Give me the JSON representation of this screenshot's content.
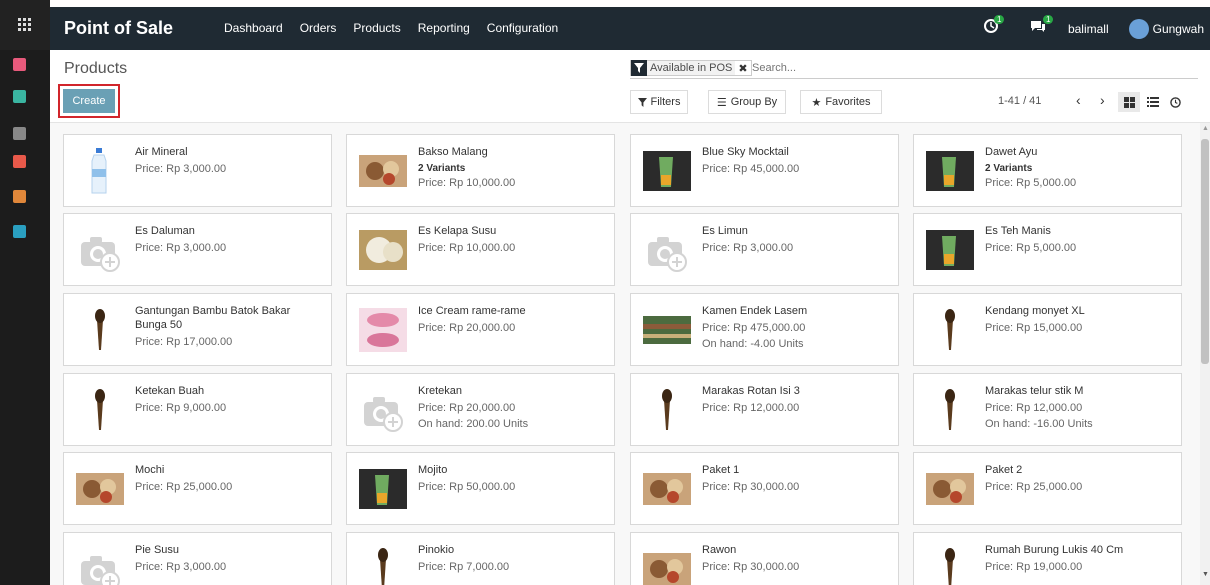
{
  "navbar": {
    "brand": "Point of Sale",
    "menu": [
      "Dashboard",
      "Orders",
      "Products",
      "Reporting",
      "Configuration"
    ],
    "activity_count": "1",
    "message_count": "1",
    "company": "balimall",
    "user": "Gungwah"
  },
  "control": {
    "title": "Products",
    "create_label": "Create",
    "facet_label": "Available in POS",
    "search_placeholder": "Search...",
    "filters_label": "Filters",
    "groupby_label": "Group By",
    "favorites_label": "Favorites",
    "pager": "1-41 / 41"
  },
  "products": [
    {
      "name": "Air Mineral",
      "variants": "",
      "price": "Price: Rp 3,000.00",
      "onhand": "",
      "icon": "water-bottle-icon"
    },
    {
      "name": "Bakso Malang",
      "variants": "2 Variants",
      "price": "Price: Rp 10,000.00",
      "onhand": "",
      "icon": "food-photo-icon"
    },
    {
      "name": "Blue Sky Mocktail",
      "variants": "",
      "price": "Price: Rp 45,000.00",
      "onhand": "",
      "icon": "drink-photo-icon"
    },
    {
      "name": "Dawet Ayu",
      "variants": "2 Variants",
      "price": "Price: Rp 5,000.00",
      "onhand": "",
      "icon": "drink-photo-icon"
    },
    {
      "name": "Es Daluman",
      "variants": "",
      "price": "Price: Rp 3,000.00",
      "onhand": "",
      "icon": "camera-placeholder-icon"
    },
    {
      "name": "Es Kelapa Susu",
      "variants": "",
      "price": "Price: Rp 10,000.00",
      "onhand": "",
      "icon": "coconut-photo-icon"
    },
    {
      "name": "Es Limun",
      "variants": "",
      "price": "Price: Rp 3,000.00",
      "onhand": "",
      "icon": "camera-placeholder-icon"
    },
    {
      "name": "Es Teh Manis",
      "variants": "",
      "price": "Price: Rp 5,000.00",
      "onhand": "",
      "icon": "drink-photo-icon"
    },
    {
      "name": "Gantungan Bambu Batok Bakar Bunga 50",
      "variants": "",
      "price": "Price: Rp 17,000.00",
      "onhand": "",
      "icon": "craft-photo-icon"
    },
    {
      "name": "Ice Cream rame-rame",
      "variants": "",
      "price": "Price: Rp 20,000.00",
      "onhand": "",
      "icon": "icecream-photo-icon"
    },
    {
      "name": "Kamen Endek Lasem",
      "variants": "",
      "price": "Price: Rp 475,000.00",
      "onhand": "On hand: -4.00 Units",
      "icon": "fabric-photo-icon"
    },
    {
      "name": "Kendang monyet XL",
      "variants": "",
      "price": "Price: Rp 15,000.00",
      "onhand": "",
      "icon": "craft-photo-icon"
    },
    {
      "name": "Ketekan Buah",
      "variants": "",
      "price": "Price: Rp 9,000.00",
      "onhand": "",
      "icon": "craft-photo-icon"
    },
    {
      "name": "Kretekan",
      "variants": "",
      "price": "Price: Rp 20,000.00",
      "onhand": "On hand: 200.00 Units",
      "icon": "camera-placeholder-icon"
    },
    {
      "name": "Marakas Rotan Isi 3",
      "variants": "",
      "price": "Price: Rp 12,000.00",
      "onhand": "",
      "icon": "craft-photo-icon"
    },
    {
      "name": "Marakas telur stik M",
      "variants": "",
      "price": "Price: Rp 12,000.00",
      "onhand": "On hand: -16.00 Units",
      "icon": "craft-photo-icon"
    },
    {
      "name": "Mochi",
      "variants": "",
      "price": "Price: Rp 25,000.00",
      "onhand": "",
      "icon": "food-photo-icon"
    },
    {
      "name": "Mojito",
      "variants": "",
      "price": "Price: Rp 50,000.00",
      "onhand": "",
      "icon": "drink-photo-icon"
    },
    {
      "name": "Paket 1",
      "variants": "",
      "price": "Price: Rp 30,000.00",
      "onhand": "",
      "icon": "food-photo-icon"
    },
    {
      "name": "Paket 2",
      "variants": "",
      "price": "Price: Rp 25,000.00",
      "onhand": "",
      "icon": "food-photo-icon"
    },
    {
      "name": "Pie Susu",
      "variants": "",
      "price": "Price: Rp 3,000.00",
      "onhand": "",
      "icon": "camera-placeholder-icon"
    },
    {
      "name": "Pinokio",
      "variants": "",
      "price": "Price: Rp 7,000.00",
      "onhand": "",
      "icon": "craft-photo-icon"
    },
    {
      "name": "Rawon",
      "variants": "",
      "price": "Price: Rp 30,000.00",
      "onhand": "",
      "icon": "food-photo-icon"
    },
    {
      "name": "Rumah Burung Lukis 40 Cm",
      "variants": "",
      "price": "Price: Rp 19,000.00",
      "onhand": "",
      "icon": "craft-photo-icon"
    }
  ]
}
